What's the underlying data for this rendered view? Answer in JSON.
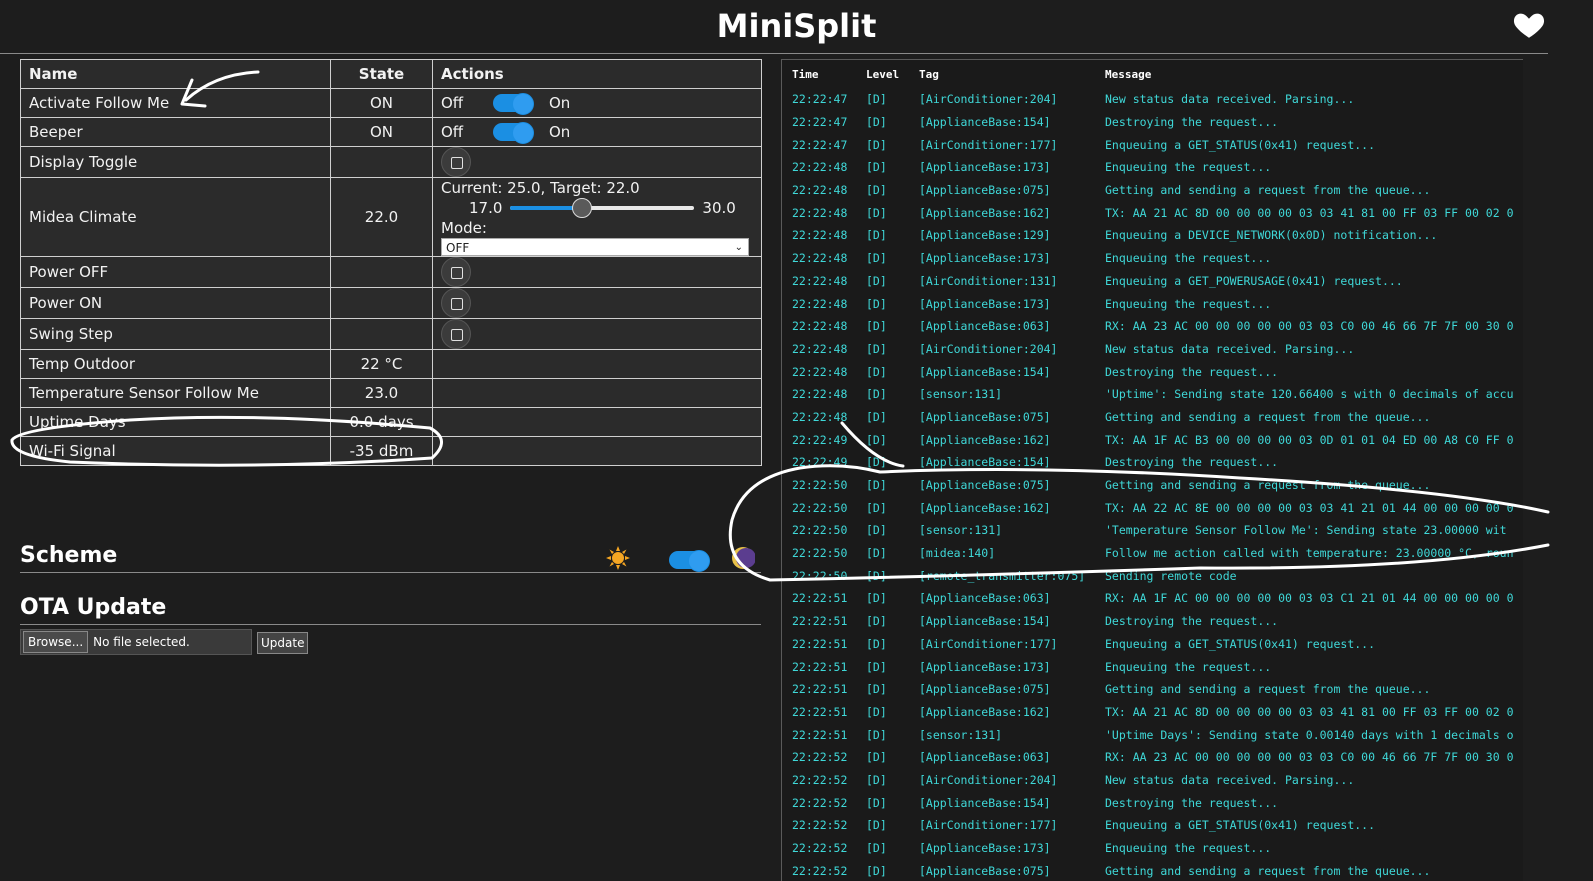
{
  "header": {
    "title": "MiniSplit",
    "heart_icon": "heart-icon"
  },
  "entities": {
    "headers": {
      "name": "Name",
      "state": "State",
      "actions": "Actions"
    },
    "switch_off_label": "Off",
    "switch_on_label": "On",
    "rows": [
      {
        "name": "Activate Follow Me",
        "state": "ON",
        "type": "switch",
        "on": true
      },
      {
        "name": "Beeper",
        "state": "ON",
        "type": "switch",
        "on": true
      },
      {
        "name": "Display Toggle",
        "state": "",
        "type": "button"
      },
      {
        "name": "Midea Climate",
        "state": "22.0",
        "type": "climate"
      },
      {
        "name": "Power OFF",
        "state": "",
        "type": "button"
      },
      {
        "name": "Power ON",
        "state": "",
        "type": "button"
      },
      {
        "name": "Swing Step",
        "state": "",
        "type": "button"
      },
      {
        "name": "Temp Outdoor",
        "state": "22 °C",
        "type": "sensor"
      },
      {
        "name": "Temperature Sensor Follow Me",
        "state": "23.0",
        "type": "sensor"
      },
      {
        "name": "Uptime Days",
        "state": "0.0 days",
        "type": "sensor"
      },
      {
        "name": "Wi-Fi Signal",
        "state": "-35 dBm",
        "type": "sensor"
      }
    ],
    "climate": {
      "status": "Current: 25.0, Target: 22.0",
      "min": "17.0",
      "max": "30.0",
      "target_fraction": 0.385,
      "mode_label": "Mode:",
      "mode_value": "OFF"
    }
  },
  "scheme": {
    "title": "Scheme",
    "dark_mode": true
  },
  "ota": {
    "title": "OTA Update",
    "browse_label": "Browse...",
    "file_status": "No file selected.",
    "update_label": "Update"
  },
  "log": {
    "headers": {
      "time": "Time",
      "level": "Level",
      "tag": "Tag",
      "message": "Message"
    },
    "rows": [
      [
        "22:22:47",
        "[D]",
        "[AirConditioner:204]",
        "New status data received. Parsing..."
      ],
      [
        "22:22:47",
        "[D]",
        "[ApplianceBase:154]",
        "Destroying the request..."
      ],
      [
        "22:22:47",
        "[D]",
        "[AirConditioner:177]",
        "Enqueuing a GET_STATUS(0x41) request..."
      ],
      [
        "22:22:48",
        "[D]",
        "[ApplianceBase:173]",
        "Enqueuing the request..."
      ],
      [
        "22:22:48",
        "[D]",
        "[ApplianceBase:075]",
        "Getting and sending a request from the queue..."
      ],
      [
        "22:22:48",
        "[D]",
        "[ApplianceBase:162]",
        "TX: AA 21 AC 8D 00 00 00 00 03 03 41 81 00 FF 03 FF 00 02 0"
      ],
      [
        "22:22:48",
        "[D]",
        "[ApplianceBase:129]",
        "Enqueuing a DEVICE_NETWORK(0x0D) notification..."
      ],
      [
        "22:22:48",
        "[D]",
        "[ApplianceBase:173]",
        "Enqueuing the request..."
      ],
      [
        "22:22:48",
        "[D]",
        "[AirConditioner:131]",
        "Enqueuing a GET_POWERUSAGE(0x41) request..."
      ],
      [
        "22:22:48",
        "[D]",
        "[ApplianceBase:173]",
        "Enqueuing the request..."
      ],
      [
        "22:22:48",
        "[D]",
        "[ApplianceBase:063]",
        "RX: AA 23 AC 00 00 00 00 00 03 03 C0 00 46 66 7F 7F 00 30 0"
      ],
      [
        "22:22:48",
        "[D]",
        "[AirConditioner:204]",
        "New status data received. Parsing..."
      ],
      [
        "22:22:48",
        "[D]",
        "[ApplianceBase:154]",
        "Destroying the request..."
      ],
      [
        "22:22:48",
        "[D]",
        "[sensor:131]",
        "'Uptime': Sending state 120.66400 s with 0 decimals of accu"
      ],
      [
        "22:22:48",
        "[D]",
        "[ApplianceBase:075]",
        "Getting and sending a request from the queue..."
      ],
      [
        "22:22:49",
        "[D]",
        "[ApplianceBase:162]",
        "TX: AA 1F AC B3 00 00 00 00 03 0D 01 01 04 ED 00 A8 C0 FF 0"
      ],
      [
        "22:22:49",
        "[D]",
        "[ApplianceBase:154]",
        "Destroying the request..."
      ],
      [
        "22:22:50",
        "[D]",
        "[ApplianceBase:075]",
        "Getting and sending a request from the queue..."
      ],
      [
        "22:22:50",
        "[D]",
        "[ApplianceBase:162]",
        "TX: AA 22 AC 8E 00 00 00 00 03 03 41 21 01 44 00 00 00 00 0"
      ],
      [
        "22:22:50",
        "[D]",
        "[sensor:131]",
        "'Temperature Sensor Follow Me': Sending state 23.00000  wit"
      ],
      [
        "22:22:50",
        "[D]",
        "[midea:140]",
        "Follow me action called with temperature: 23.00000 °C, roun"
      ],
      [
        "22:22:50",
        "[D]",
        "[remote_transmitter:075]",
        "Sending remote code"
      ],
      [
        "22:22:51",
        "[D]",
        "[ApplianceBase:063]",
        "RX: AA 1F AC 00 00 00 00 00 03 03 C1 21 01 44 00 00 00 00 0"
      ],
      [
        "22:22:51",
        "[D]",
        "[ApplianceBase:154]",
        "Destroying the request..."
      ],
      [
        "22:22:51",
        "[D]",
        "[AirConditioner:177]",
        "Enqueuing a GET_STATUS(0x41) request..."
      ],
      [
        "22:22:51",
        "[D]",
        "[ApplianceBase:173]",
        "Enqueuing the request..."
      ],
      [
        "22:22:51",
        "[D]",
        "[ApplianceBase:075]",
        "Getting and sending a request from the queue..."
      ],
      [
        "22:22:51",
        "[D]",
        "[ApplianceBase:162]",
        "TX: AA 21 AC 8D 00 00 00 00 03 03 41 81 00 FF 03 FF 00 02 0"
      ],
      [
        "22:22:51",
        "[D]",
        "[sensor:131]",
        "'Uptime Days': Sending state 0.00140 days with 1 decimals o"
      ],
      [
        "22:22:52",
        "[D]",
        "[ApplianceBase:063]",
        "RX: AA 23 AC 00 00 00 00 00 03 03 C0 00 46 66 7F 7F 00 30 0"
      ],
      [
        "22:22:52",
        "[D]",
        "[AirConditioner:204]",
        "New status data received. Parsing..."
      ],
      [
        "22:22:52",
        "[D]",
        "[ApplianceBase:154]",
        "Destroying the request..."
      ],
      [
        "22:22:52",
        "[D]",
        "[AirConditioner:177]",
        "Enqueuing a GET_STATUS(0x41) request..."
      ],
      [
        "22:22:52",
        "[D]",
        "[ApplianceBase:173]",
        "Enqueuing the request..."
      ],
      [
        "22:22:52",
        "[D]",
        "[ApplianceBase:075]",
        "Getting and sending a request from the queue..."
      ]
    ]
  },
  "colors": {
    "background": "#1d1d1d",
    "log_text": "#3fd8d8",
    "accent": "#1b8fe3",
    "annotation": "#ffffff"
  }
}
